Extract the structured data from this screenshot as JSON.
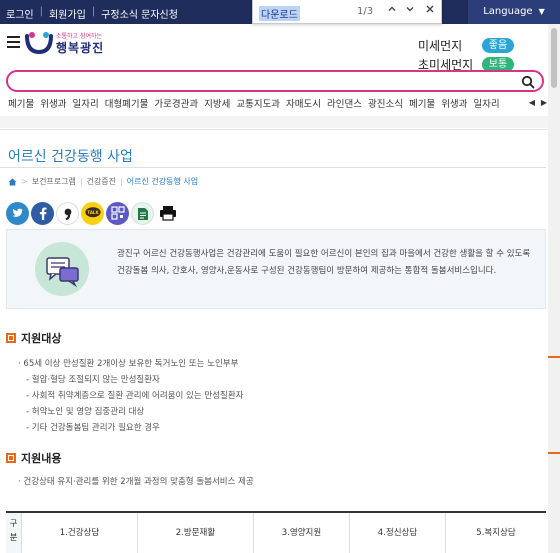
{
  "topbar": {
    "links": [
      "로그인",
      "회원가입",
      "구정소식 문자신청"
    ],
    "language": "Language"
  },
  "findbar": {
    "query": "다운로드",
    "count": "1/3",
    "up_icon": "chevron-up-icon",
    "down_icon": "chevron-down-icon",
    "close_icon": "close-icon"
  },
  "header": {
    "logo_small": "소통하고 참여하는",
    "logo_big": "행복광진",
    "dust": [
      {
        "label": "미세먼지",
        "status": "좋음",
        "color": "#2aa5d6"
      },
      {
        "label": "초미세먼지",
        "status": "보통",
        "color": "#2fb57a"
      }
    ]
  },
  "search": {
    "placeholder": "",
    "value": ""
  },
  "keywords": [
    "페기물",
    "위생과",
    "일자리",
    "대형폐기물",
    "가로경관과",
    "지방세",
    "교통지도과",
    "자매도시",
    "라인댄스",
    "광진소식",
    "페기물",
    "위생과",
    "일자리"
  ],
  "keyword_nav": {
    "prev": "◀",
    "next": "▶"
  },
  "page": {
    "title": "어르신 건강동행 사업",
    "breadcrumb": [
      "보건프로그램",
      "건강증진",
      "어르신 건강동행 사업"
    ],
    "share": [
      {
        "name": "twitter-share-button",
        "label": "t",
        "color": "#2f89c9"
      },
      {
        "name": "facebook-share-button",
        "label": "f",
        "color": "#2d5ba4"
      },
      {
        "name": "kakaostory-share-button",
        "label": ",",
        "color": "#222"
      },
      {
        "name": "kakaotalk-share-button",
        "label": "TALK",
        "color": "#f7d10f"
      },
      {
        "name": "qr-share-button",
        "label": "QR",
        "color": "#5b59c4"
      },
      {
        "name": "document-share-button",
        "label": "D",
        "color": "#1f7a48"
      },
      {
        "name": "print-button",
        "label": "P",
        "color": "#111"
      }
    ],
    "intro": "광진구 어르신 건강동행사업은 건강관리에 도움이 필요한 어르신이 본인의 집과 마을에서 건강한 생활을 할 수 있도록 건강돌봄 의사, 간호사, 영양사,운동사로 구성된 건강동행팀이 방문하여 제공하는 통합적 돌봄서비스입니다.",
    "target_title": "지원대상",
    "target_items": [
      "65세 이상 만성질환 2개이상 보유한 독거노인 또는 노인부부",
      "- 혈압·혈당 조절되지 않는 만성질환자",
      "- 사회적 취약계층으로 질환 관리에 어려움이 있는 만성질환자",
      "- 허약노인 및 영양 집중관리 대상",
      "- 기타 건강돌봄팀 관리가 필요한 경우"
    ],
    "content_title": "지원내용",
    "content_items": [
      "건강상태 유지·관리를 위한 2개월 과정의 맞춤형 돌봄서비스 제공"
    ],
    "table_header": "구분",
    "table_cells": [
      "1.건강상담",
      "2.방문재활",
      "3.영양지원",
      "4.정신상담",
      "5.복지상담"
    ]
  }
}
